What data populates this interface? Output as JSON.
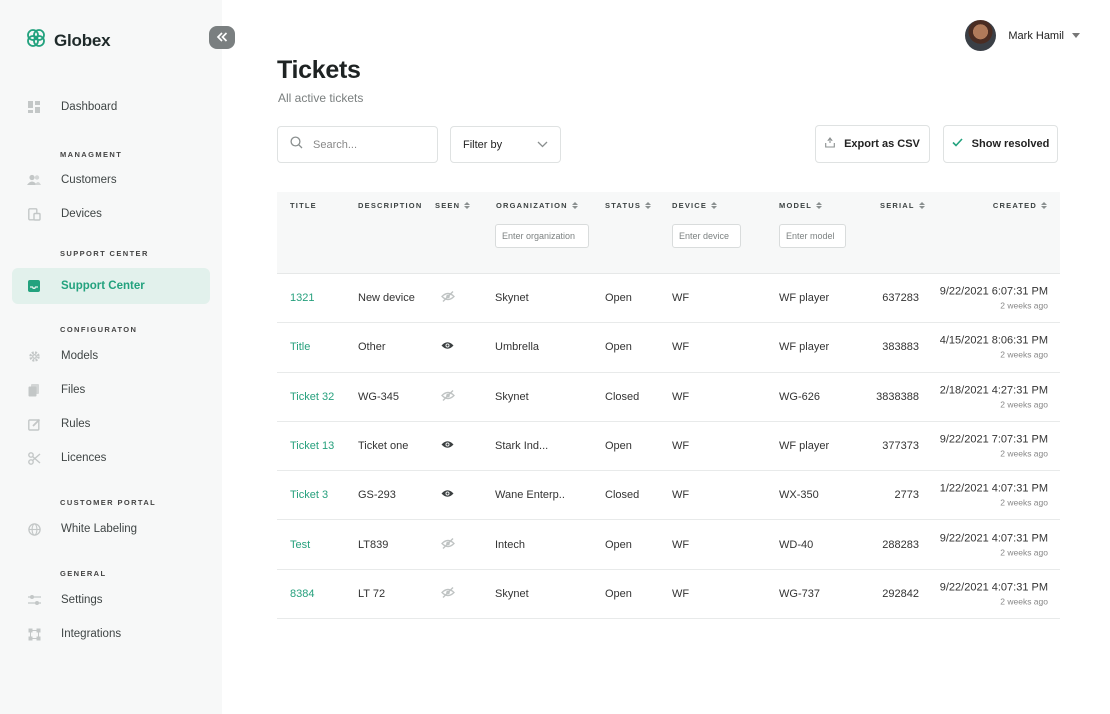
{
  "app": {
    "name": "Globex",
    "brand_color": "#23a27e"
  },
  "sidebar": {
    "collapse_icon": "double-chevron-left-icon",
    "dashboard": {
      "label": "Dashboard",
      "icon": "grid-icon"
    },
    "sections": [
      {
        "label": "MANAGMENT",
        "items": [
          {
            "label": "Customers",
            "icon": "users-icon"
          },
          {
            "label": "Devices",
            "icon": "devices-icon"
          }
        ]
      },
      {
        "label": "SUPPORT CENTER",
        "items": [
          {
            "label": "Support Center",
            "icon": "inbox-icon",
            "active": true
          }
        ]
      },
      {
        "label": "CONFIGURATON",
        "items": [
          {
            "label": "Models",
            "icon": "gear-icon"
          },
          {
            "label": "Files",
            "icon": "files-icon"
          },
          {
            "label": "Rules",
            "icon": "edit-icon"
          },
          {
            "label": "Licences",
            "icon": "licence-icon"
          }
        ]
      },
      {
        "label": "CUSTOMER PORTAL",
        "items": [
          {
            "label": "White Labeling",
            "icon": "globe-icon"
          }
        ]
      },
      {
        "label": "GENERAL",
        "items": [
          {
            "label": "Settings",
            "icon": "sliders-icon"
          },
          {
            "label": "Integrations",
            "icon": "integrations-icon"
          }
        ]
      }
    ]
  },
  "header": {
    "user_name": "Mark Hamil"
  },
  "page": {
    "title": "Tickets",
    "subtitle": "All active tickets"
  },
  "toolbar": {
    "search_placeholder": "Search...",
    "filter_label": "Filter by",
    "export_label": "Export as CSV",
    "resolved_label": "Show resolved"
  },
  "table": {
    "columns": {
      "title": "TITLE",
      "description": "DESCRIPTION",
      "seen": "SEEN",
      "organization": "ORGANIZATION",
      "status": "STATUS",
      "device": "DEVICE",
      "model": "MODEL",
      "serial": "SERIAL",
      "created": "CREATED"
    },
    "filters": {
      "organization_placeholder": "Enter organization",
      "device_placeholder": "Enter device",
      "model_placeholder": "Enter model"
    },
    "rows": [
      {
        "title": "1321",
        "description": "New device",
        "seen": false,
        "organization": "Skynet",
        "status": "Open",
        "device": "WF",
        "model": "WF player",
        "serial": "637283",
        "created_date": "9/22/2021 6:07:31 PM",
        "created_ago": "2 weeks ago"
      },
      {
        "title": "Title",
        "description": "Other",
        "seen": true,
        "organization": "Umbrella",
        "status": "Open",
        "device": "WF",
        "model": "WF player",
        "serial": "383883",
        "created_date": "4/15/2021 8:06:31 PM",
        "created_ago": "2 weeks ago"
      },
      {
        "title": "Ticket 32",
        "description": "WG-345",
        "seen": false,
        "organization": "Skynet",
        "status": "Closed",
        "device": "WF",
        "model": "WG-626",
        "serial": "3838388",
        "created_date": "2/18/2021 4:27:31 PM",
        "created_ago": "2 weeks ago"
      },
      {
        "title": "Ticket 13",
        "description": "Ticket one",
        "seen": true,
        "organization": "Stark Ind...",
        "status": "Open",
        "device": "WF",
        "model": "WF player",
        "serial": "377373",
        "created_date": "9/22/2021 7:07:31 PM",
        "created_ago": "2 weeks ago"
      },
      {
        "title": "Ticket 3",
        "description": "GS-293",
        "seen": true,
        "organization": "Wane Enterp..",
        "status": "Closed",
        "device": "WF",
        "model": "WX-350",
        "serial": "2773",
        "created_date": "1/22/2021 4:07:31 PM",
        "created_ago": "2 weeks ago"
      },
      {
        "title": "Test",
        "description": "LT839",
        "seen": false,
        "organization": "Intech",
        "status": "Open",
        "device": "WF",
        "model": "WD-40",
        "serial": "288283",
        "created_date": "9/22/2021 4:07:31 PM",
        "created_ago": "2 weeks ago"
      },
      {
        "title": "8384",
        "description": "LT 72",
        "seen": false,
        "organization": "Skynet",
        "status": "Open",
        "device": "WF",
        "model": "WG-737",
        "serial": "292842",
        "created_date": "9/22/2021 4:07:31 PM",
        "created_ago": "2 weeks ago"
      }
    ]
  }
}
